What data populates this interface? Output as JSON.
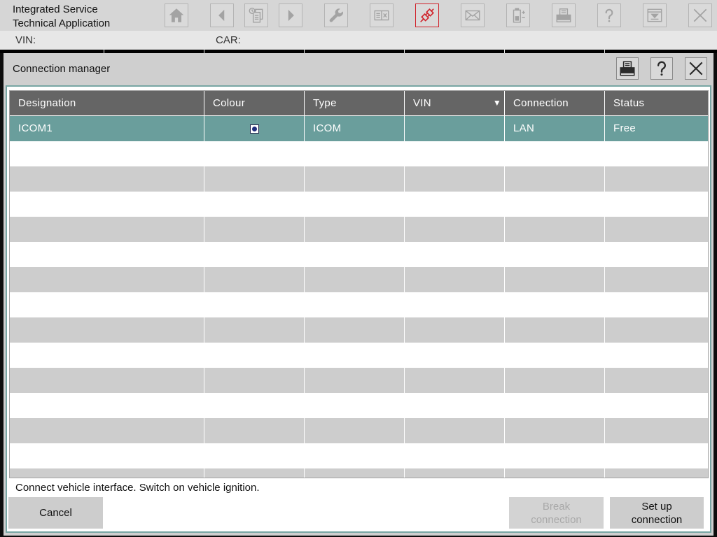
{
  "app": {
    "title_line1": "Integrated Service",
    "title_line2": "Technical Application"
  },
  "toolbar": {
    "icons": [
      "home-icon",
      "back-icon",
      "history-icon",
      "forward-icon",
      "wrench-icon",
      "compare-icon",
      "connection-icon",
      "mail-icon",
      "battery-icon",
      "print-icon",
      "help-icon",
      "menu-icon",
      "close-icon"
    ],
    "active_icon": "connection-icon"
  },
  "vehicle": {
    "vin_label": "VIN:",
    "vin_value": "",
    "car_label": "CAR:",
    "car_value": ""
  },
  "dialog": {
    "title": "Connection manager",
    "header_icons": [
      "print-icon",
      "help-icon",
      "close-icon"
    ],
    "table": {
      "columns": [
        "Designation",
        "Colour",
        "Type",
        "VIN",
        "Connection",
        "Status"
      ],
      "sort_column": "VIN",
      "sort_indicator": "▼",
      "rows": [
        {
          "designation": "ICOM1",
          "colour": "#1f2d7c",
          "type": "ICOM",
          "vin": "",
          "connection": "LAN",
          "status": "Free",
          "selected": true
        }
      ]
    },
    "status_message": "Connect vehicle interface. Switch on vehicle ignition.",
    "buttons": {
      "cancel": "Cancel",
      "break_connection": "Break connection",
      "break_connection_enabled": false,
      "set_up_connection": "Set up connection"
    }
  },
  "colors": {
    "selected_row": "#6a9e9c",
    "header": "#656565",
    "row_alt": "#cdcdcd",
    "active_toolbar": "#d0232b",
    "panel_border": "#78a6a4"
  }
}
